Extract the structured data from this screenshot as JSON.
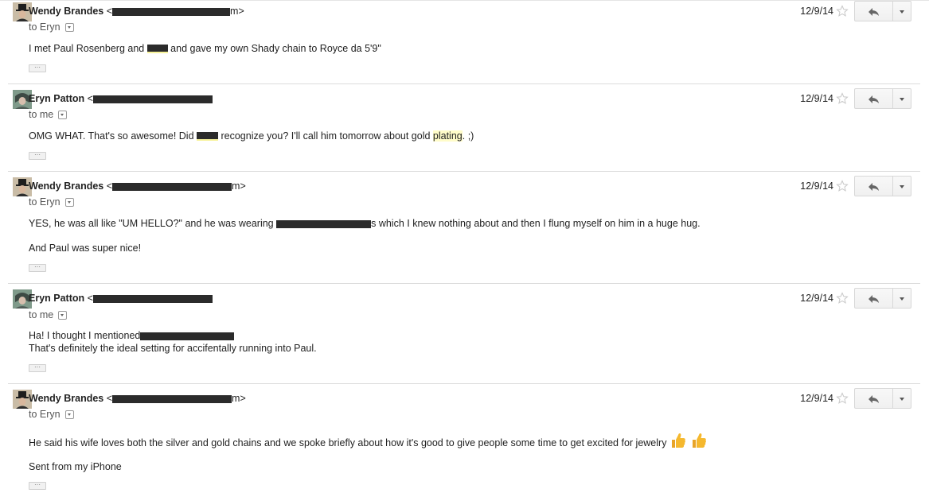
{
  "messages": [
    {
      "sender": "Wendy Brandes",
      "email_prefix": "<",
      "email_suffix": "m>",
      "recipient": "to Eryn",
      "date": "12/9/14",
      "lines": [
        {
          "parts": [
            "I met Paul Rosenberg and ",
            " and gave my own Shady chain to Royce da 5'9\""
          ]
        }
      ]
    },
    {
      "sender": "Eryn Patton",
      "email_prefix": "<",
      "recipient": "to me",
      "date": "12/9/14",
      "lines": [
        {
          "parts": [
            "OMG WHAT. That's so awesome! Did ",
            " recognize you? I'll call him tomorrow about gold ",
            "plating",
            ". ;)"
          ]
        }
      ]
    },
    {
      "sender": "Wendy Brandes",
      "email_prefix": "<",
      "email_suffix": "m>",
      "recipient": "to Eryn",
      "date": "12/9/14",
      "lines": [
        {
          "parts": [
            "YES, he was all like \"UM HELLO?\" and he was wearing ",
            "s which I knew nothing about and then I flung myself on him in a huge hug."
          ]
        },
        {
          "parts": [
            "And Paul was super nice!"
          ]
        }
      ]
    },
    {
      "sender": "Eryn Patton",
      "email_prefix": "<",
      "recipient": "to me",
      "date": "12/9/14",
      "lines": [
        {
          "parts": [
            "Ha! I thought I mentioned"
          ]
        },
        {
          "parts": [
            "That's definitely the ideal setting for accifentally running into Paul."
          ]
        }
      ]
    },
    {
      "sender": "Wendy Brandes",
      "email_prefix": "<",
      "email_suffix": "m>",
      "recipient": "to Eryn",
      "date": "12/9/14",
      "lines": [
        {
          "parts": [
            "He said his wife loves both the silver and gold chains and we spoke briefly about how it's good to give people some time to get excited for jewelry"
          ]
        },
        {
          "parts": [
            "Sent from my iPhone"
          ]
        }
      ]
    }
  ],
  "more_label": "···",
  "icons": {
    "star": "star-icon",
    "reply": "reply-arrow-icon",
    "more": "dropdown-arrow-icon",
    "recipient_toggle": "recipient-details-icon",
    "thumbs_up": "thumbs-up-emoji"
  },
  "colors": {
    "highlight": "#fffcc9",
    "redaction": "#2b2b2b",
    "separator": "#dcdcdc"
  }
}
